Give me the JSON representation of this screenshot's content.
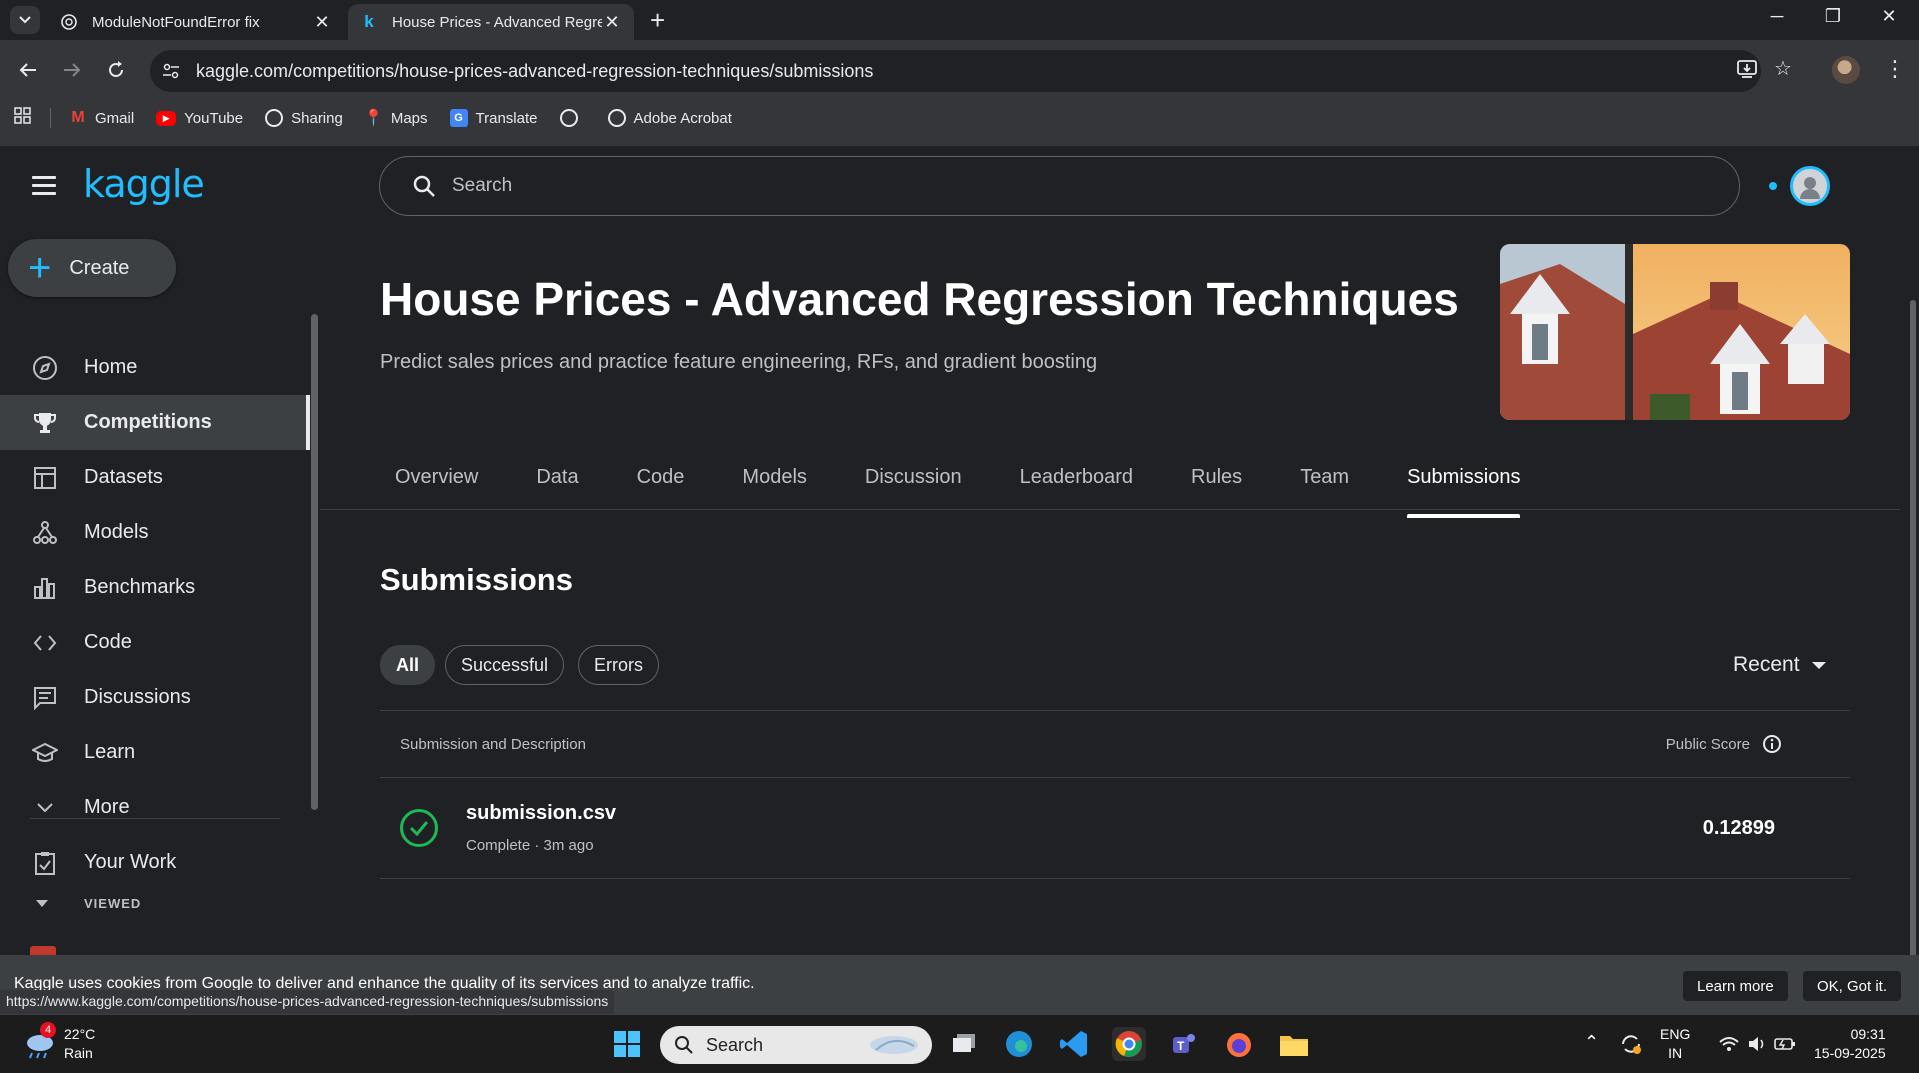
{
  "browser": {
    "tabs": [
      {
        "title": "ModuleNotFoundError fix",
        "icon": "openai-icon",
        "active": false
      },
      {
        "title": "House Prices - Advanced Regre",
        "icon": "kaggle-k-icon",
        "active": true
      }
    ],
    "address": {
      "domain": "kaggle.com",
      "path": "/competitions/house-prices-advanced-regression-techniques/submissions"
    },
    "bookmarks": [
      "Gmail",
      "YouTube",
      "Sharing",
      "Maps",
      "Translate",
      "",
      "Adobe Acrobat"
    ]
  },
  "kaggle": {
    "logo": "kaggle",
    "create_label": "Create",
    "nav": [
      {
        "label": "Home",
        "icon": "compass-icon"
      },
      {
        "label": "Competitions",
        "icon": "trophy-icon"
      },
      {
        "label": "Datasets",
        "icon": "table-icon"
      },
      {
        "label": "Models",
        "icon": "models-icon"
      },
      {
        "label": "Benchmarks",
        "icon": "bar-chart-icon"
      },
      {
        "label": "Code",
        "icon": "code-icon"
      },
      {
        "label": "Discussions",
        "icon": "discussion-icon"
      },
      {
        "label": "Learn",
        "icon": "school-icon"
      },
      {
        "label": "More",
        "icon": "chevron-down-icon"
      }
    ],
    "your_work_label": "Your Work",
    "viewed_label": "VIEWED",
    "search_placeholder": "Search"
  },
  "competition": {
    "title": "House Prices - Advanced Regression Techniques",
    "subtitle": "Predict sales prices and practice feature engineering, RFs, and gradient boosting",
    "tabs": [
      "Overview",
      "Data",
      "Code",
      "Models",
      "Discussion",
      "Leaderboard",
      "Rules",
      "Team",
      "Submissions"
    ],
    "active_tab": "Submissions"
  },
  "submissions": {
    "heading": "Submissions",
    "filters": [
      "All",
      "Successful",
      "Errors"
    ],
    "sort_label": "Recent",
    "col_submission": "Submission and Description",
    "col_score": "Public Score",
    "rows": [
      {
        "file": "submission.csv",
        "meta": "Complete · 3m ago",
        "score": "0.12899",
        "status": "success"
      }
    ]
  },
  "cookie_banner": {
    "text": "Kaggle uses cookies from Google to deliver and enhance the quality of its services and to analyze traffic.",
    "learn_more": "Learn more",
    "ok": "OK, Got it."
  },
  "status_url": "https://www.kaggle.com/competitions/house-prices-advanced-regression-techniques/submissions",
  "taskbar": {
    "weather_temp": "22°C",
    "weather_desc": "Rain",
    "weather_badge": "4",
    "search_label": "Search",
    "lang_top": "ENG",
    "lang_bottom": "IN",
    "time": "09:31",
    "date": "15-09-2025"
  },
  "colors": {
    "kaggle_blue": "#20beff",
    "success_green": "#1db954",
    "page_bg": "#202124"
  }
}
